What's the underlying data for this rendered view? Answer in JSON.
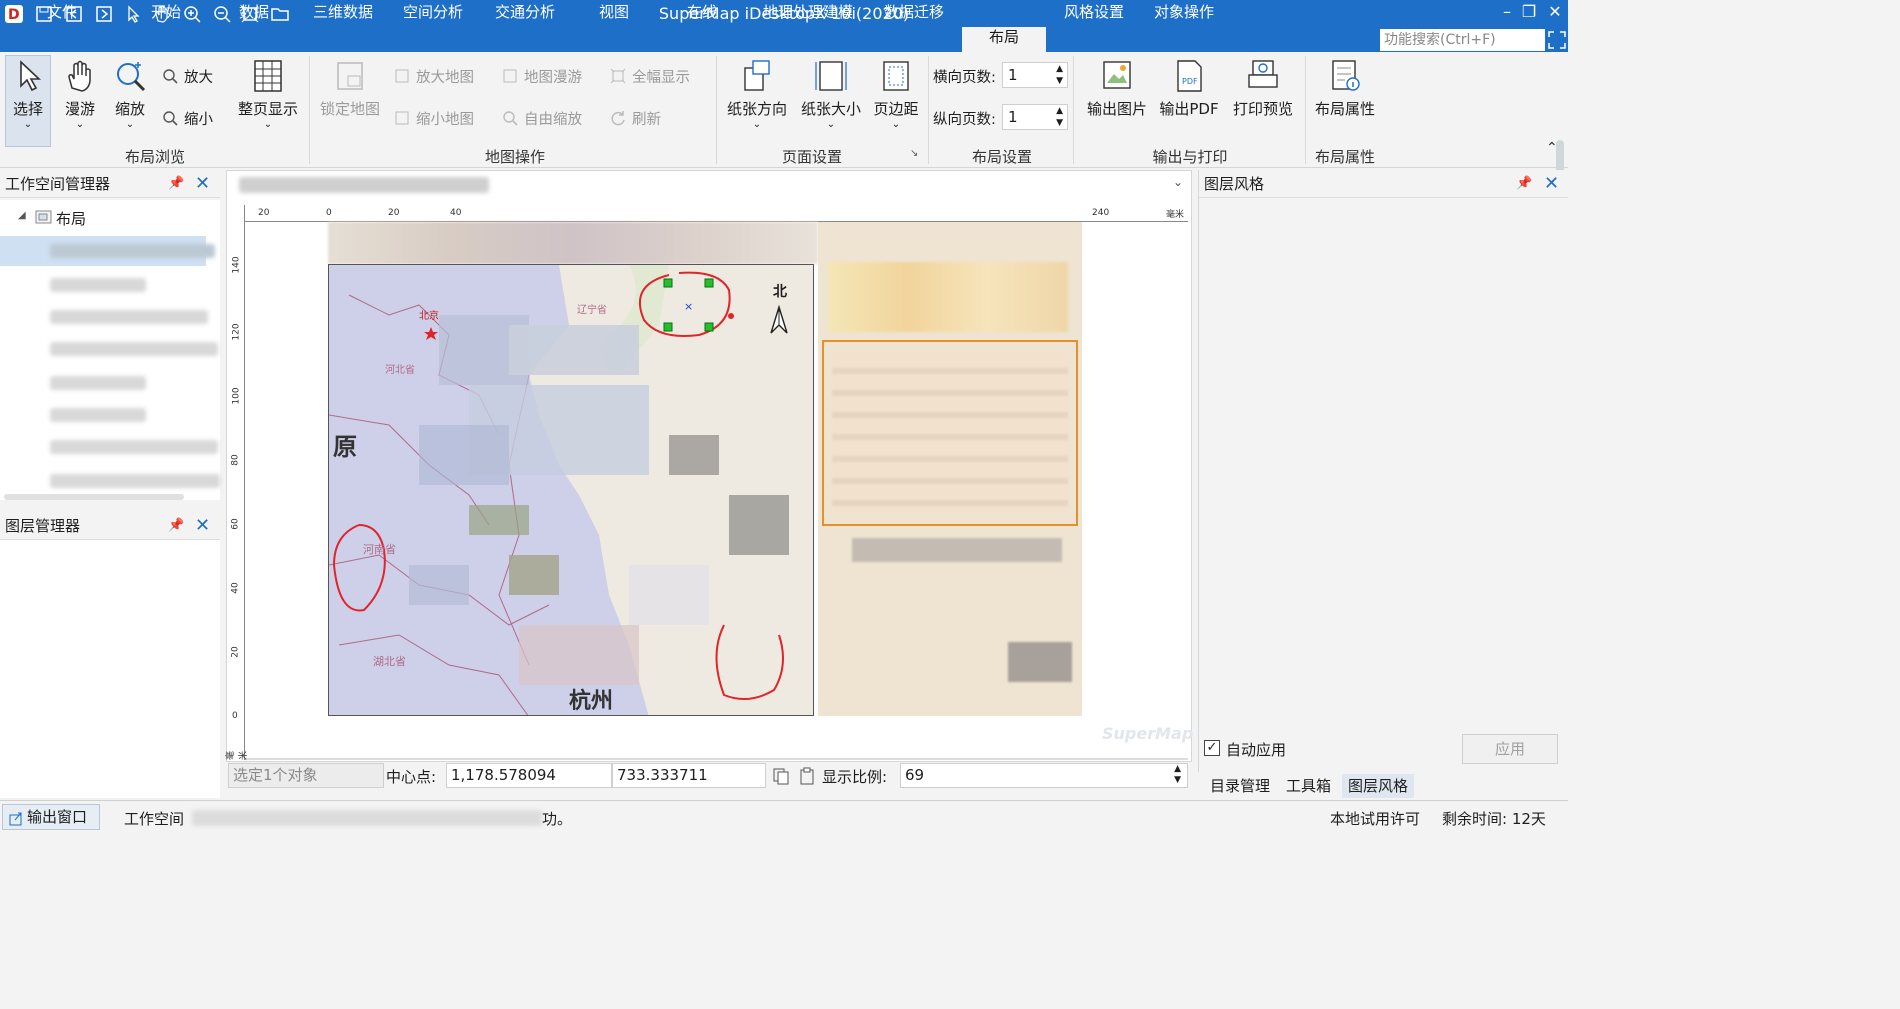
{
  "app": {
    "title": "SuperMap iDesktopX 10i(2020)"
  },
  "menu": {
    "tabs": [
      "文件",
      "开始",
      "数据",
      "三维数据",
      "空间分析",
      "交通分析",
      "视图",
      "在线",
      "地理处理建模",
      "数据迁移",
      "布局",
      "风格设置",
      "对象操作"
    ],
    "search_placeholder": "功能搜索(Ctrl+F)"
  },
  "ribbon": {
    "browse": {
      "select": "选择",
      "pan": "漫游",
      "zoom": "缩放",
      "zoom_in": "放大",
      "zoom_out": "缩小",
      "full_page": "整页显示",
      "group": "布局浏览"
    },
    "mapops": {
      "lock_map": "锁定地图",
      "enlarge_map": "放大地图",
      "shrink_map": "缩小地图",
      "map_pan": "地图漫游",
      "free_zoom": "自由缩放",
      "full_extent": "全幅显示",
      "refresh": "刷新",
      "group": "地图操作"
    },
    "page": {
      "orientation": "纸张方向",
      "size": "纸张大小",
      "margins": "页边距",
      "group": "页面设置"
    },
    "layout": {
      "h_pages_label": "横向页数:",
      "h_pages": "1",
      "v_pages_label": "纵向页数:",
      "v_pages": "1",
      "group": "布局设置"
    },
    "output": {
      "image": "输出图片",
      "pdf": "输出PDF",
      "preview": "打印预览",
      "group": "输出与打印"
    },
    "props": {
      "label": "布局属性",
      "group": "布局属性"
    }
  },
  "workspace": {
    "title": "工作空间管理器",
    "root": "布局"
  },
  "layers": {
    "title": "图层管理器"
  },
  "layout_view": {
    "ruler_top": [
      "20",
      "0",
      "20",
      "40",
      "240",
      "毫米"
    ],
    "ruler_left": [
      "140",
      "120",
      "100",
      "80",
      "60",
      "40",
      "20",
      "0",
      "毫米"
    ],
    "map_labels": {
      "north": "北",
      "city": "杭州",
      "province1": "河南省",
      "province2": "湖北省",
      "char": "原",
      "beijing": "北京",
      "hebei": "河北省",
      "liaoning": "辽宁省"
    },
    "watermark": "SuperMap"
  },
  "layout_status": {
    "selected": "选定1个对象",
    "center_label": "中心点:",
    "center_x": "1,178.578094",
    "center_y": "733.333711",
    "scale_label": "显示比例:",
    "scale": "69"
  },
  "right_panel": {
    "title": "图层风格",
    "auto_apply": "自动应用",
    "apply": "应用",
    "tabs": [
      "目录管理",
      "工具箱",
      "图层风格"
    ]
  },
  "statusbar": {
    "output": "输出窗口",
    "workspace": "工作空间",
    "msg_tail": "功。",
    "license": "本地试用许可",
    "remaining": "剩余时间: 12天"
  },
  "colors": {
    "brand": "#1e6fc7",
    "map_bg": "#cdd0e8",
    "annotation": "#e0242a"
  }
}
